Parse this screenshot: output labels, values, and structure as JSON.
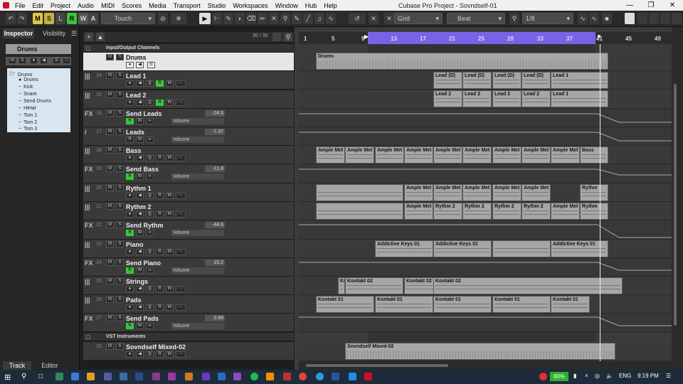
{
  "menubar": {
    "items": [
      "File",
      "Edit",
      "Project",
      "Audio",
      "MIDI",
      "Scores",
      "Media",
      "Transport",
      "Studio",
      "Workspaces",
      "Window",
      "Hub",
      "Help"
    ],
    "window_title": "Cubase Pro Project - Sovndself-01"
  },
  "toolbar": {
    "m": "M",
    "s": "S",
    "l": "L",
    "r": "R",
    "w": "W",
    "a": "A",
    "automation_mode": "Touch",
    "snap_type": "Grid",
    "grid_type": "Beat",
    "quantize": "1/8"
  },
  "inspector": {
    "tabs": [
      "Inspector",
      "Visibility"
    ],
    "track_name": "Drums",
    "tree": [
      "Drums",
      "Drums",
      "Kick",
      "Snare",
      "Send Drums",
      "HiHat",
      "Tom 1",
      "Tom 2",
      "Tom 3"
    ],
    "bottom_tabs": [
      "Track",
      "Editor"
    ]
  },
  "tracklist": {
    "count": "35 / 35",
    "folder_io": "Input/Output Channels",
    "folder_vst": "VST Instruments",
    "tracks": [
      {
        "num": "",
        "type": "",
        "name": "Drums",
        "vol": ""
      },
      {
        "num": "14",
        "type": "|||",
        "name": "Lead 1",
        "vol": ""
      },
      {
        "num": "15",
        "type": "|||",
        "name": "Lead 2",
        "vol": ""
      },
      {
        "num": "16",
        "type": "FX",
        "name": "Send Leads",
        "vol": "-24.5"
      },
      {
        "num": "17",
        "type": "/",
        "name": "Leads",
        "vol": "-7.37"
      },
      {
        "num": "18",
        "type": "|||",
        "name": "Bass",
        "vol": ""
      },
      {
        "num": "19",
        "type": "FX",
        "name": "Send Bass",
        "vol": "-11.8"
      },
      {
        "num": "20",
        "type": "|||",
        "name": "Rythm 1",
        "vol": ""
      },
      {
        "num": "21",
        "type": "|||",
        "name": "Rythm 2",
        "vol": ""
      },
      {
        "num": "22",
        "type": "FX",
        "name": "Send Rythm",
        "vol": "-44.6"
      },
      {
        "num": "23",
        "type": "|||",
        "name": "Piano",
        "vol": ""
      },
      {
        "num": "24",
        "type": "FX",
        "name": "Send Piano",
        "vol": "15.2"
      },
      {
        "num": "25",
        "type": "|||",
        "name": "Strings",
        "vol": ""
      },
      {
        "num": "26",
        "type": "|||",
        "name": "Pads",
        "vol": ""
      },
      {
        "num": "27",
        "type": "FX",
        "name": "Send Pads",
        "vol": "0.69"
      },
      {
        "num": "28",
        "type": "",
        "name": "Sovndself Mixed-02",
        "vol": ""
      }
    ],
    "volume_label": "Volume"
  },
  "ruler": [
    "1",
    "5",
    "9",
    "13",
    "17",
    "21",
    "25",
    "29",
    "33",
    "37",
    "41",
    "45",
    "49"
  ],
  "events": {
    "drums": "Drums",
    "lead1": [
      "Lead (D)",
      "Lead (D)",
      "Lead (D)",
      "Lead (D)",
      "Lead 1"
    ],
    "lead2": [
      "Lead 2",
      "Lead 2",
      "Lead 2",
      "Lead 2",
      "Lead 1"
    ],
    "bass": [
      "Ample Met",
      "Ample Met",
      "Ample Met",
      "Ample Met",
      "Ample Met",
      "Ample Met",
      "Ample Met",
      "Ample Met",
      "Ample Met",
      "Bass"
    ],
    "rythm1": [
      "Ample Met",
      "Ample Met",
      "Ample Met",
      "Ample Met",
      "Ample Met",
      "Rythm"
    ],
    "rythm2": [
      "Ample Met",
      "Rythm 2",
      "Rythm 2",
      "Rythm 2",
      "Rythm 2",
      "Ample Met",
      "Rythm"
    ],
    "piano": [
      "Addictive Keys 01",
      "Addictive Keys 01",
      "Addictive Keys 01"
    ],
    "strings": [
      "Kc",
      "Kontakt 02",
      "Kontakt 02",
      "Kontakt 02"
    ],
    "pads": [
      "Kontakt 01",
      "Kontakt 01",
      "Kontakt 01",
      "Kontakt 01",
      "Kontakt 01"
    ],
    "audio": "Sovndself Mixed-02"
  },
  "taskbar": {
    "battery": "60%",
    "lang": "ENG",
    "time": "9:19 PM"
  }
}
